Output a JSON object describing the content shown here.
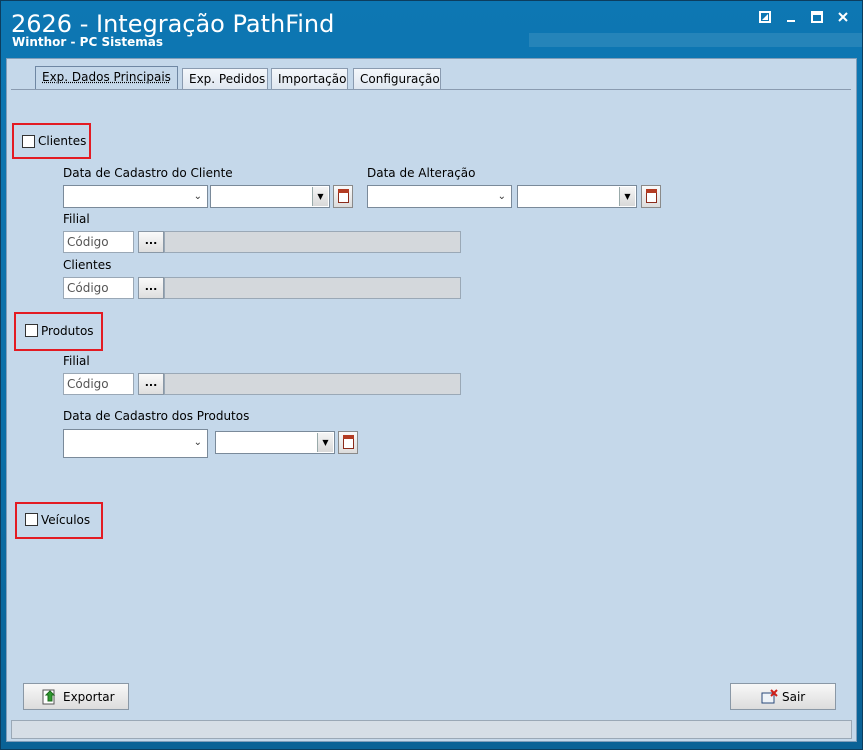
{
  "window": {
    "title": "2626 - Integração PathFind",
    "subtitle": "Winthor - PC Sistemas"
  },
  "tabs": [
    {
      "label": "Exp. Dados Principais",
      "active": true
    },
    {
      "label": "Exp. Pedidos",
      "active": false
    },
    {
      "label": "Importação",
      "active": false
    },
    {
      "label": "Configuração",
      "active": false
    }
  ],
  "clientes": {
    "checkbox_label": "Clientes",
    "checked": false,
    "data_cadastro_label": "Data de Cadastro do Cliente",
    "data_alteracao_label": "Data de Alteração",
    "filial_label": "Filial",
    "filial_placeholder": "Código",
    "clientes_label": "Clientes",
    "clientes_placeholder": "Código"
  },
  "produtos": {
    "checkbox_label": "Produtos",
    "checked": false,
    "filial_label": "Filial",
    "filial_placeholder": "Código",
    "data_cadastro_label": "Data de Cadastro dos Produtos"
  },
  "veiculos": {
    "checkbox_label": "Veículos",
    "checked": false
  },
  "buttons": {
    "ellipsis": "...",
    "exportar": "Exportar",
    "sair": "Sair"
  },
  "colors": {
    "titlebar": "#0b6ea6",
    "client_bg": "#c5d8ea",
    "highlight": "#e31b23"
  }
}
